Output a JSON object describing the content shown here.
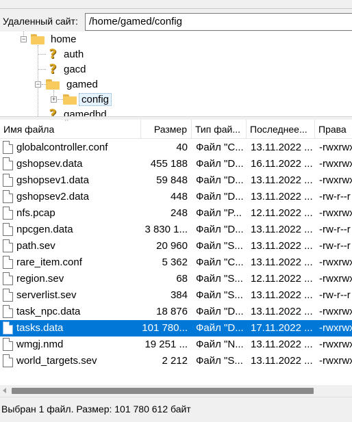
{
  "remote_site": {
    "label": "Удаленный сайт:",
    "path": "/home/gamed/config"
  },
  "tree": {
    "nodes": [
      {
        "label": "home",
        "icon": "folder-icon"
      },
      {
        "label": "auth",
        "icon": "question-icon"
      },
      {
        "label": "gacd",
        "icon": "question-icon"
      },
      {
        "label": "gamed",
        "icon": "folder-icon"
      },
      {
        "label": "config",
        "icon": "folder-icon"
      },
      {
        "label": "gamedbd",
        "icon": "question-icon"
      }
    ]
  },
  "columns": {
    "name": "Имя файла",
    "size": "Размер",
    "type": "Тип фай...",
    "modified": "Последнее...",
    "rights": "Права"
  },
  "files": [
    {
      "name": "globalcontroller.conf",
      "size": "40",
      "type": "Файл \"C...",
      "modified": "13.11.2022 ...",
      "rights": "-rwxrwx"
    },
    {
      "name": "gshopsev.data",
      "size": "455 188",
      "type": "Файл \"D...",
      "modified": "16.11.2022 ...",
      "rights": "-rwxrwx"
    },
    {
      "name": "gshopsev1.data",
      "size": "59 848",
      "type": "Файл \"D...",
      "modified": "13.11.2022 ...",
      "rights": "-rwxrwx"
    },
    {
      "name": "gshopsev2.data",
      "size": "448",
      "type": "Файл \"D...",
      "modified": "13.11.2022 ...",
      "rights": "-rw-r--r"
    },
    {
      "name": "nfs.pcap",
      "size": "248",
      "type": "Файл \"P...",
      "modified": "12.11.2022 ...",
      "rights": "-rwxrwx"
    },
    {
      "name": "npcgen.data",
      "size": "3 830 1...",
      "type": "Файл \"D...",
      "modified": "13.11.2022 ...",
      "rights": "-rw-r--r"
    },
    {
      "name": "path.sev",
      "size": "20 960",
      "type": "Файл \"S...",
      "modified": "13.11.2022 ...",
      "rights": "-rw-r--r"
    },
    {
      "name": "rare_item.conf",
      "size": "5 362",
      "type": "Файл \"C...",
      "modified": "13.11.2022 ...",
      "rights": "-rwxrwx"
    },
    {
      "name": "region.sev",
      "size": "68",
      "type": "Файл \"S...",
      "modified": "12.11.2022 ...",
      "rights": "-rwxrwx"
    },
    {
      "name": "serverlist.sev",
      "size": "384",
      "type": "Файл \"S...",
      "modified": "13.11.2022 ...",
      "rights": "-rw-r--r"
    },
    {
      "name": "task_npc.data",
      "size": "18 876",
      "type": "Файл \"D...",
      "modified": "13.11.2022 ...",
      "rights": "-rwxrwx"
    },
    {
      "name": "tasks.data",
      "size": "101 780...",
      "type": "Файл \"D...",
      "modified": "17.11.2022 ...",
      "rights": "-rwxrwx",
      "selected": true
    },
    {
      "name": "wmgj.nmd",
      "size": "19 251 ...",
      "type": "Файл \"N...",
      "modified": "13.11.2022 ...",
      "rights": "-rwxrwx"
    },
    {
      "name": "world_targets.sev",
      "size": "2 212",
      "type": "Файл \"S...",
      "modified": "13.11.2022 ...",
      "rights": "-rwxrwx"
    }
  ],
  "status": "Выбран 1 файл. Размер: 101 780 612 байт",
  "colors": {
    "selection": "#0078d7",
    "folder": "#f7cb5e",
    "question_icon": "#d8a21c"
  }
}
